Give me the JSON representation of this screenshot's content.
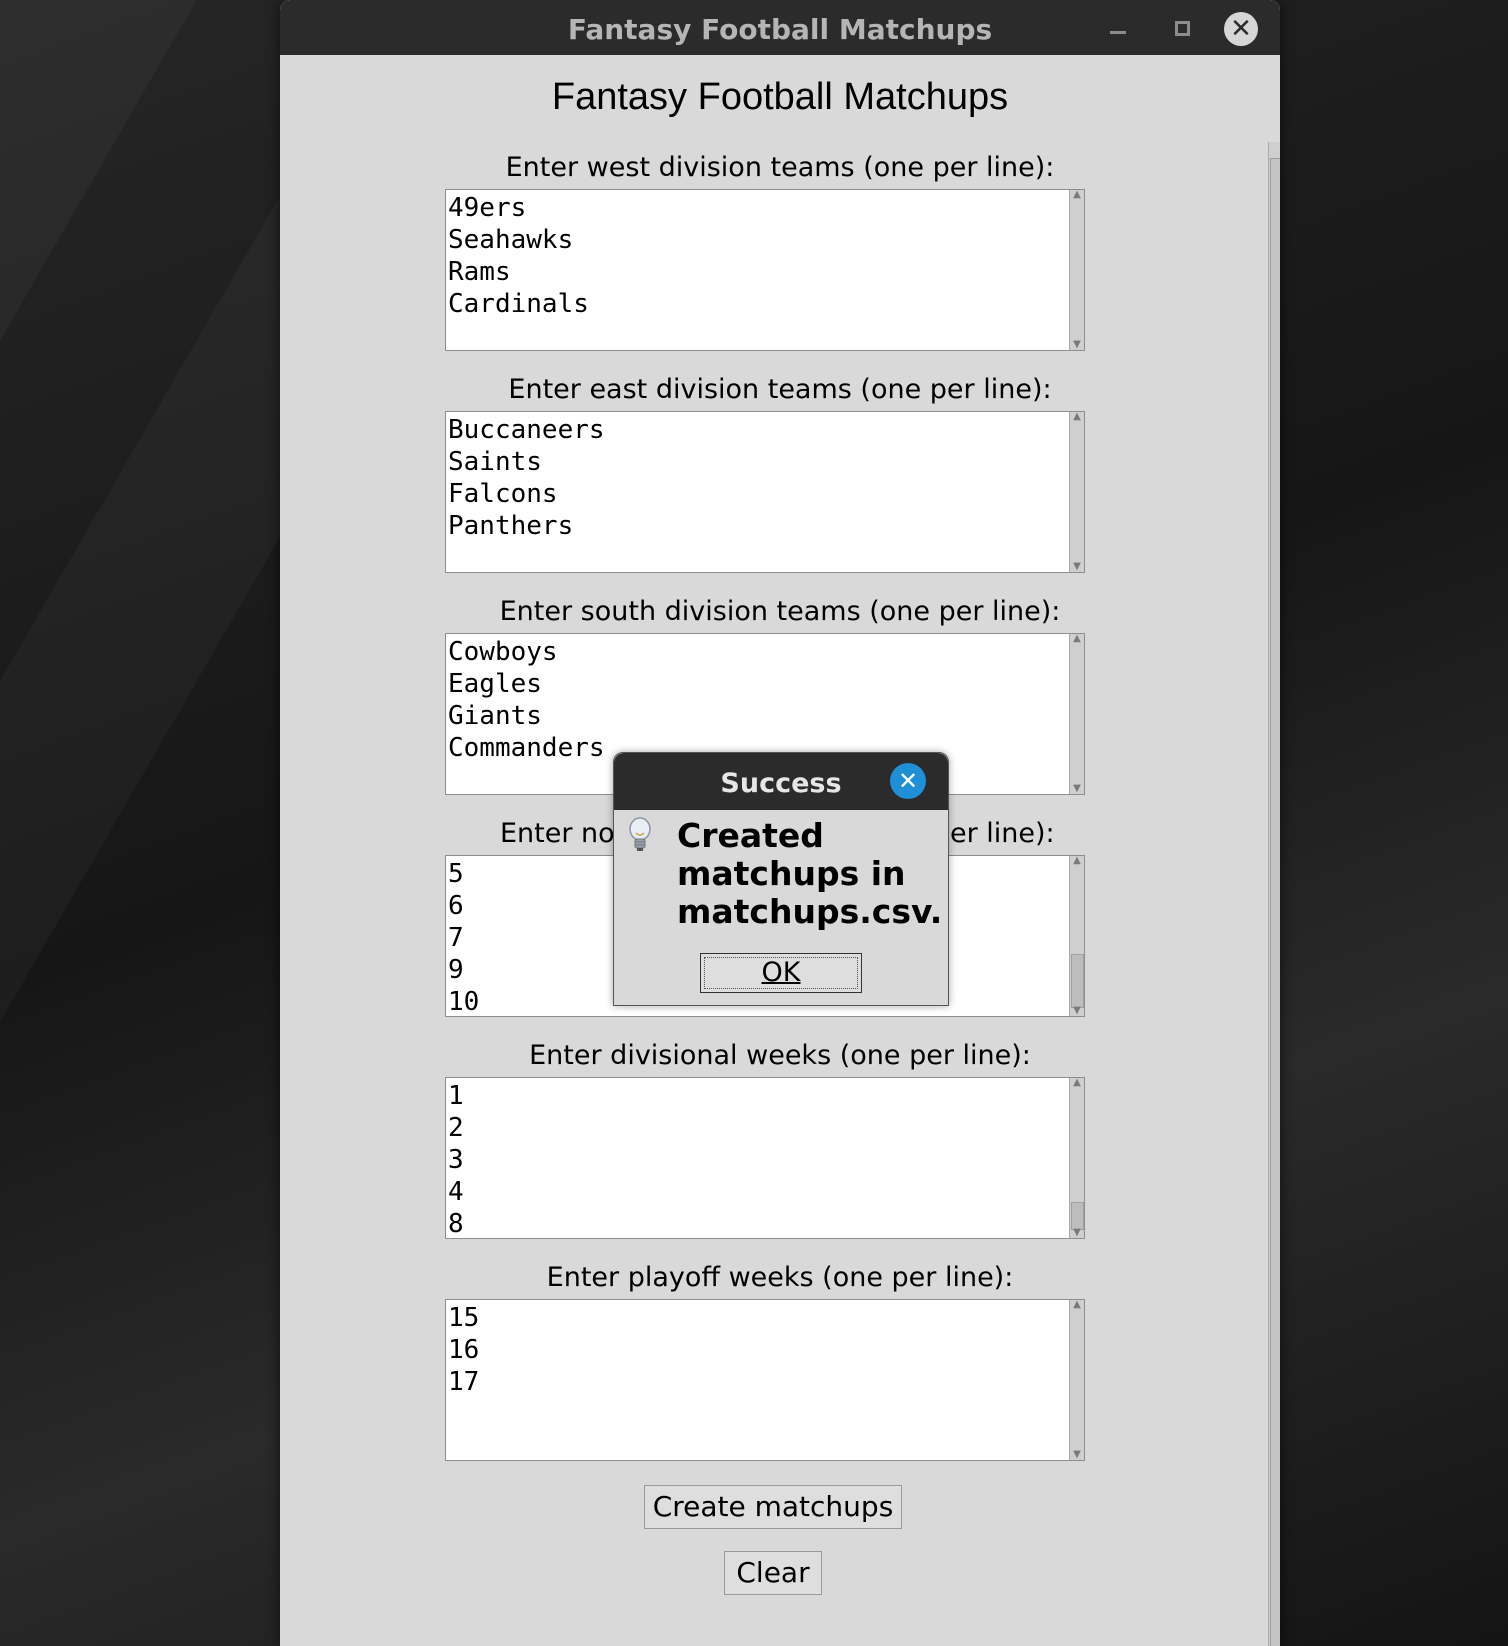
{
  "window": {
    "title": "Fantasy Football Matchups"
  },
  "app": {
    "heading": "Fantasy Football Matchups"
  },
  "fields": [
    {
      "label": "Enter west division teams (one per line):",
      "value": "49ers\nSeahawks\nRams\nCardinals"
    },
    {
      "label": "Enter east division teams (one per line):",
      "value": "Buccaneers\nSaints\nFalcons\nPanthers"
    },
    {
      "label": "Enter south division teams (one per line):",
      "value": "Cowboys\nEagles\nGiants\nCommanders"
    },
    {
      "label_left": "Enter no",
      "label_right": "er line):",
      "value": "5\n6\n7\n9\n10"
    },
    {
      "label": "Enter divisional weeks (one per line):",
      "value": "1\n2\n3\n4\n8"
    },
    {
      "label": "Enter playoff weeks (one per line):",
      "value": "15\n16\n17"
    }
  ],
  "buttons": {
    "create": "Create matchups",
    "clear": "Clear"
  },
  "dialog": {
    "title": "Success",
    "message": "Created matchups in matchups.csv.",
    "ok_label": "OK",
    "icon": "lightbulb-icon"
  },
  "titlebar_icons": {
    "minimize": "minimize-icon",
    "maximize": "maximize-icon",
    "close": "close-icon"
  }
}
